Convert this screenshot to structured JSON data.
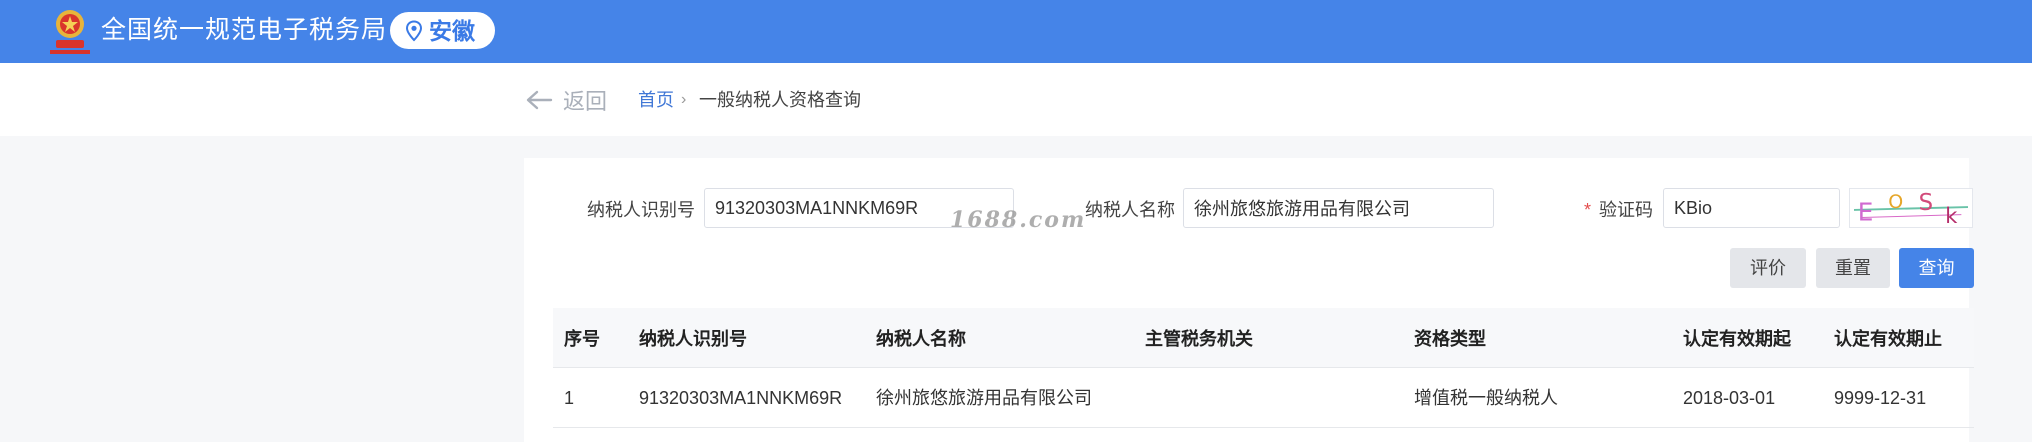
{
  "header": {
    "site_title": "全国统一规范电子税务局",
    "region": "安徽",
    "emblem_icon": "tax-emblem-icon",
    "pin_icon": "location-pin-icon",
    "brand_color": "#4584e8"
  },
  "breadcrumb": {
    "back_label": "返回",
    "home": "首页",
    "separator": "›",
    "current": "一般纳税人资格查询"
  },
  "form": {
    "taxpayer_id_label": "纳税人识别号",
    "taxpayer_id_value": "91320303MA1NNKM69R",
    "taxpayer_name_label": "纳税人名称",
    "taxpayer_name_value": "徐州旅悠旅游用品有限公司",
    "required_mark": "*",
    "captcha_label": "验证码",
    "captcha_value": "KBio",
    "captcha_image_text": "EOSk"
  },
  "watermark": "1688.com",
  "buttons": {
    "evaluate": "评价",
    "reset": "重置",
    "query": "查询"
  },
  "table": {
    "columns": [
      "序号",
      "纳税人识别号",
      "纳税人名称",
      "主管税务机关",
      "资格类型",
      "认定有效期起",
      "认定有效期止"
    ],
    "rows": [
      [
        "1",
        "91320303MA1NNKM69R",
        "徐州旅悠旅游用品有限公司",
        "",
        "增值税一般纳税人",
        "2018-03-01",
        "9999-12-31"
      ]
    ]
  }
}
